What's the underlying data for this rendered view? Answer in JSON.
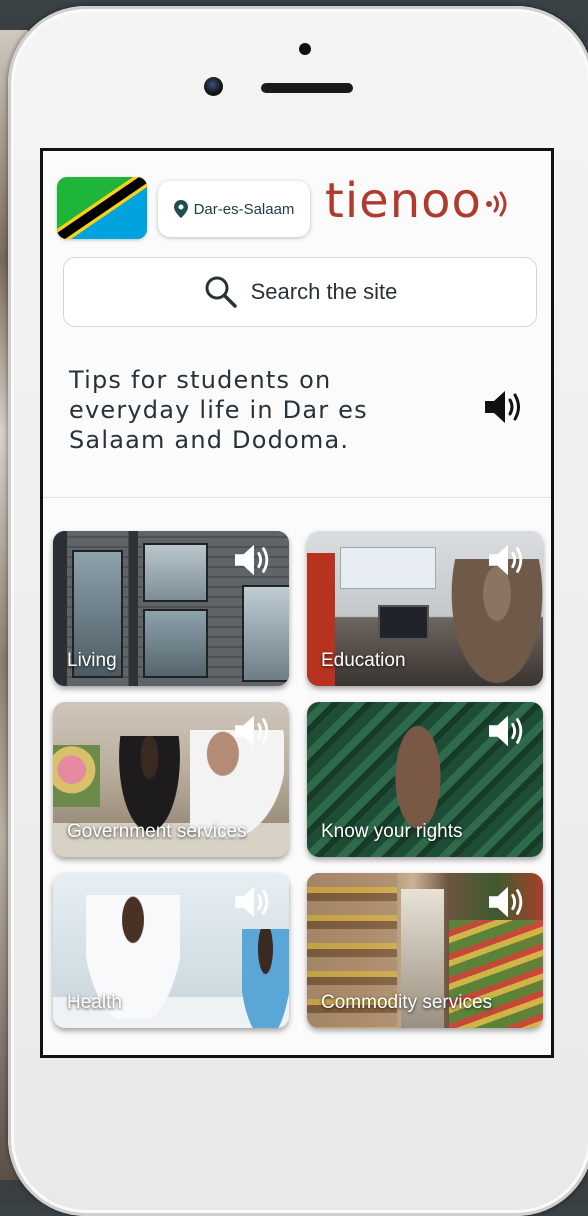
{
  "app": {
    "location": "Dar-es-Salaam",
    "logo_text": "tienoo",
    "brand_color": "#b03a2e"
  },
  "search": {
    "label": "Search the site",
    "icon": "search-icon"
  },
  "intro": {
    "text": "Tips for students on everyday life in Dar es Salaam and Dodoma.",
    "audio_icon": "speaker-icon"
  },
  "categories": [
    {
      "label": "Living"
    },
    {
      "label": "Education"
    },
    {
      "label": "Government services"
    },
    {
      "label": "Know your rights"
    },
    {
      "label": "Health"
    },
    {
      "label": "Commodity services"
    }
  ]
}
